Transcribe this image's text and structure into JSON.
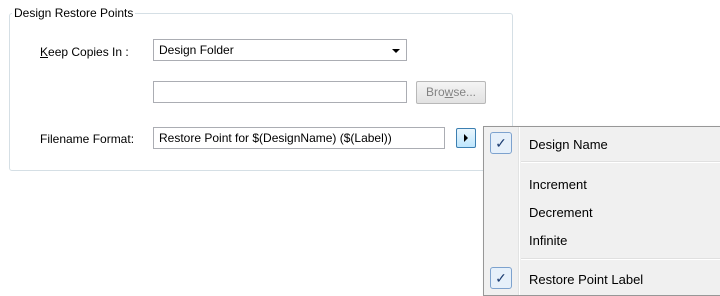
{
  "group": {
    "title": "Design Restore Points"
  },
  "keep_copies": {
    "label_prefix": "",
    "label_accel": "K",
    "label_rest": "eep Copies In :",
    "value": "Design Folder"
  },
  "path_field": {
    "value": ""
  },
  "browse": {
    "before": "Bro",
    "accel": "w",
    "after": "se..."
  },
  "filename_format": {
    "label": "Filename Format:",
    "value": "Restore Point for $(DesignName) ($(Label))"
  },
  "menu": {
    "items": [
      {
        "label": "Design Name",
        "checked": true,
        "check_glyph": "✓"
      },
      {
        "label": "Increment",
        "checked": false
      },
      {
        "label": "Decrement",
        "checked": false
      },
      {
        "label": "Infinite",
        "checked": false
      },
      {
        "label": "Restore Point Label",
        "checked": true,
        "check_glyph": "✓"
      }
    ]
  },
  "icons": {
    "dropdown": "chevron-down-icon",
    "submenu": "arrow-right-icon",
    "check": "check-icon"
  },
  "colors": {
    "border": "#abadb3",
    "check_bg": "#e6f0fa",
    "check_border": "#7da2ce",
    "menu_bg": "#f0f0f0"
  }
}
